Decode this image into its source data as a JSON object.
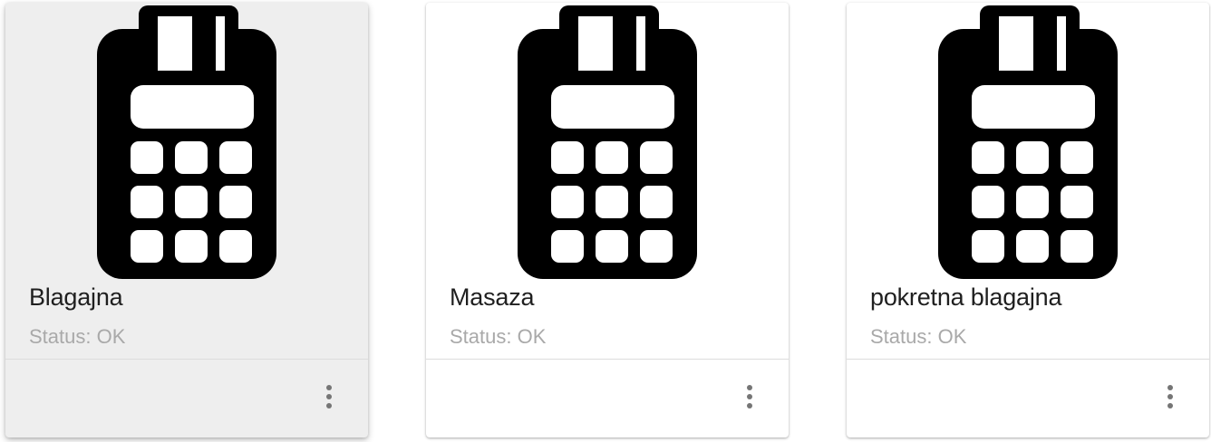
{
  "devices": [
    {
      "name": "Blagajna",
      "status": "Status: OK",
      "icon": "card-terminal-icon",
      "highlighted": true
    },
    {
      "name": "Masaza",
      "status": "Status: OK",
      "icon": "card-terminal-icon",
      "highlighted": false
    },
    {
      "name": "pokretna blagajna",
      "status": "Status: OK",
      "icon": "card-terminal-icon",
      "highlighted": false
    }
  ],
  "menu_icon": "more-vert-icon",
  "colors": {
    "card_background": "#ffffff",
    "card_highlight_background": "#eeeeee",
    "title_text": "#1f1f1f",
    "status_text": "#a9a9a9",
    "icon_fill": "#000000",
    "menu_dots": "#757575"
  }
}
